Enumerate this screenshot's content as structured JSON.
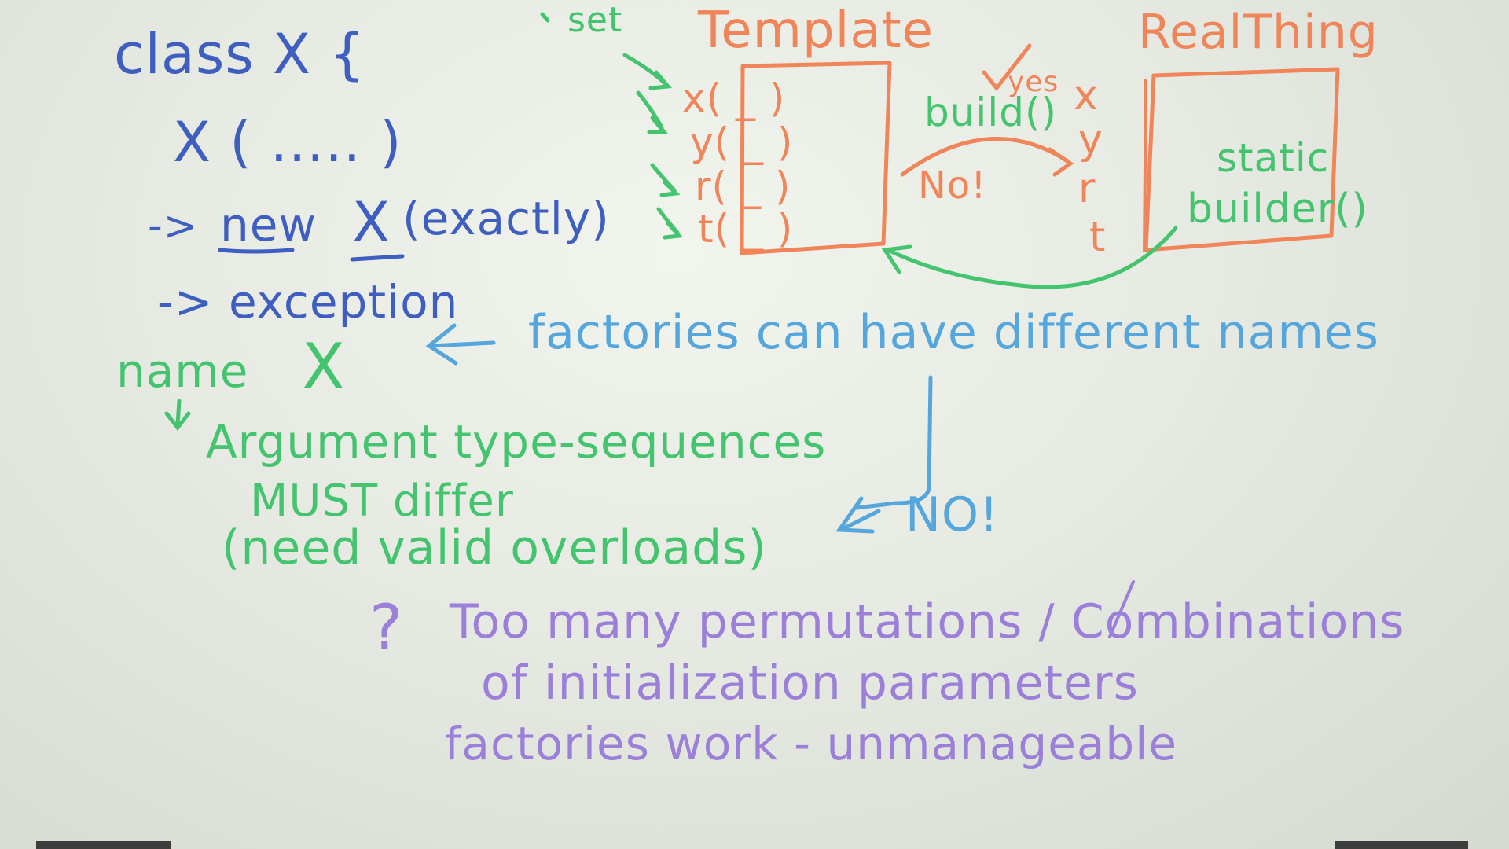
{
  "board": {
    "code": {
      "class_decl": "class X {",
      "constructor": "X ( ..... )",
      "arrow_new_prefix": "->",
      "new_kw": "new",
      "new_type": "X",
      "new_suffix": "(exactly)",
      "arrow_exception": "-> exception"
    },
    "naming": {
      "name_label": "name",
      "name_x": "X",
      "rule_line1": "Argument type-sequences",
      "rule_line2": "MUST differ",
      "rule_line3": "(need valid overloads)"
    },
    "factories_note": "factories can have different names",
    "no_answer": "NO!",
    "problem": {
      "mark": "?",
      "line1": "Too many permutations / Combinations",
      "line2": "of initialization parameters",
      "line3": "factories work - unmanageable"
    },
    "builder_diagram": {
      "set_label": "set",
      "template_title": "Template",
      "template_fields": [
        "x( _ )",
        "y( _ )",
        "r( _ )",
        "t( _ )"
      ],
      "build_label": "build()",
      "yes_label": "yes",
      "no_label": "No!",
      "realthing_title": "RealThing",
      "realthing_fields": [
        "x",
        "y",
        "r",
        "t"
      ],
      "static_label": "static",
      "builder_method": "builder()"
    },
    "colors": {
      "board": "#e9ece5",
      "blue": "#3f5fc0",
      "light_blue": "#55a6dd",
      "green": "#45c46f",
      "orange": "#f0855a",
      "purple": "#9b7fd8"
    }
  }
}
